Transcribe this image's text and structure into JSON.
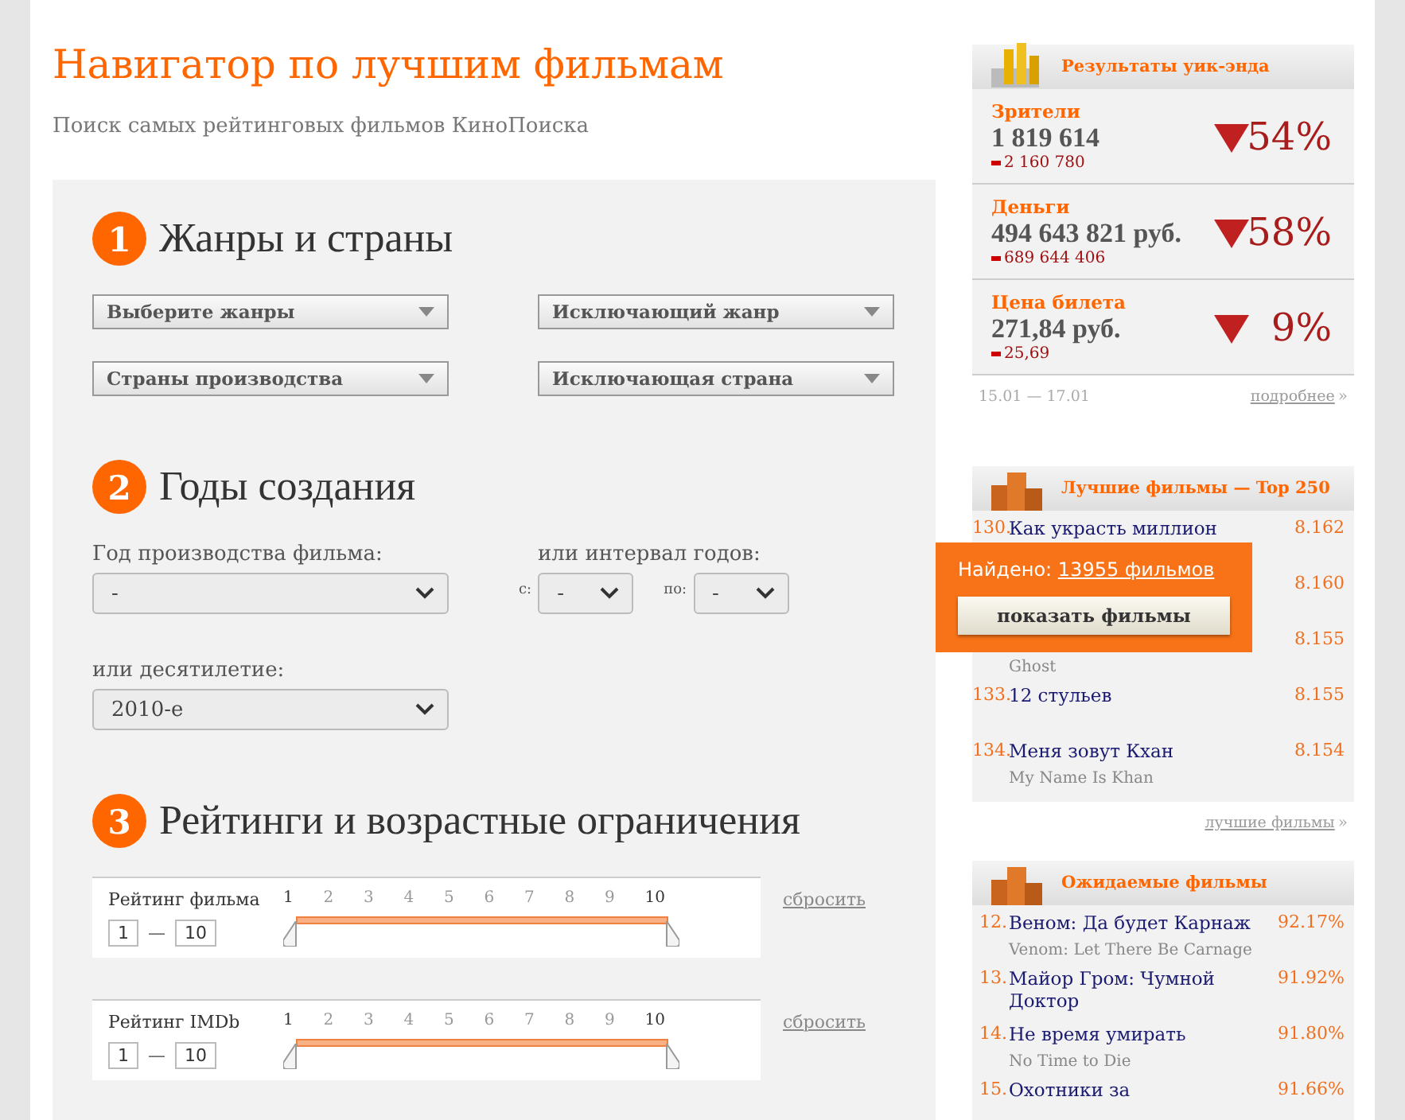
{
  "title": "Навигатор по лучшим фильмам",
  "subtitle": "Поиск самых рейтинговых фильмов КиноПоиска",
  "sections": [
    {
      "number": "1",
      "heading": "Жанры и страны",
      "kind": "dropdowns",
      "dropdowns": [
        "Выберите жанры",
        "Исключающий жанр",
        "Страны производства",
        "Исключающая страна"
      ]
    },
    {
      "number": "2",
      "heading": "Годы создания",
      "kind": "years",
      "year_label": "Год производства фильма:",
      "year_value": "-",
      "interval_label": "или интервал годов:",
      "from_label": "с:",
      "from_value": "-",
      "to_label": "по:",
      "to_value": "-",
      "decade_label": "или десятилетие:",
      "decade_value": "2010-е"
    },
    {
      "number": "3",
      "heading": "Рейтинги и возрастные ограничения",
      "kind": "ratings",
      "ratings": [
        {
          "label": "Рейтинг фильма",
          "ticks": [
            "1",
            "2",
            "3",
            "4",
            "5",
            "6",
            "7",
            "8",
            "9",
            "10"
          ],
          "min": "1",
          "dash": "—",
          "max": "10",
          "level": 1,
          "reset": "сбросить"
        },
        {
          "label": "Рейтинг IMDb",
          "ticks": [
            "1",
            "2",
            "3",
            "4",
            "5",
            "6",
            "7",
            "8",
            "9",
            "10"
          ],
          "min": "1",
          "dash": "—",
          "max": "10",
          "level": 1,
          "reset": "сбросить"
        }
      ]
    }
  ],
  "found": {
    "label": "Найдено:",
    "link": "13955 фильмов",
    "button": "показать фильмы"
  },
  "weekend": {
    "title": "Результаты уик-энда",
    "rows": [
      {
        "label": "Зрители",
        "value": "1 819 614",
        "previous": "2 160 780",
        "percent": "54%"
      },
      {
        "label": "Деньги",
        "value": "494 643 821 руб.",
        "previous": "689 644 406",
        "percent": "58%"
      },
      {
        "label": "Цена билета",
        "value": "271,84 руб.",
        "previous": "25,69",
        "percent": "9%"
      }
    ],
    "dates": "15.01 — 17.01",
    "more": "подробнее",
    "more_arrow": "»"
  },
  "top250": {
    "title": "Лучшие фильмы — Top 250",
    "items": [
      {
        "rank": "130.",
        "name": "Как украсть миллион",
        "score": "8.162"
      },
      {
        "score": "8.160"
      },
      {
        "original": "Ghost",
        "score": "8.155"
      },
      {
        "rank": "133.",
        "name": "12 стульев",
        "score": "8.155"
      },
      {
        "rank": "134.",
        "name": "Меня зовут Кхан",
        "original": "My Name Is Khan",
        "score": "8.154"
      }
    ],
    "more": "лучшие фильмы",
    "more_arrow": "»"
  },
  "expected": {
    "title": "Ожидаемые фильмы",
    "items": [
      {
        "rank": "12.",
        "name": "Веном: Да будет Карнаж",
        "original": "Venom: Let There Be Carnage",
        "score": "92.17%"
      },
      {
        "rank": "13.",
        "name": "Майор Гром: Чумной Доктор",
        "score": "91.92%"
      },
      {
        "rank": "14.",
        "name": "Не время умирать",
        "original": "No Time to Die",
        "score": "91.80%"
      },
      {
        "rank": "15.",
        "name": "Охотники за",
        "score": "91.66%"
      }
    ]
  }
}
